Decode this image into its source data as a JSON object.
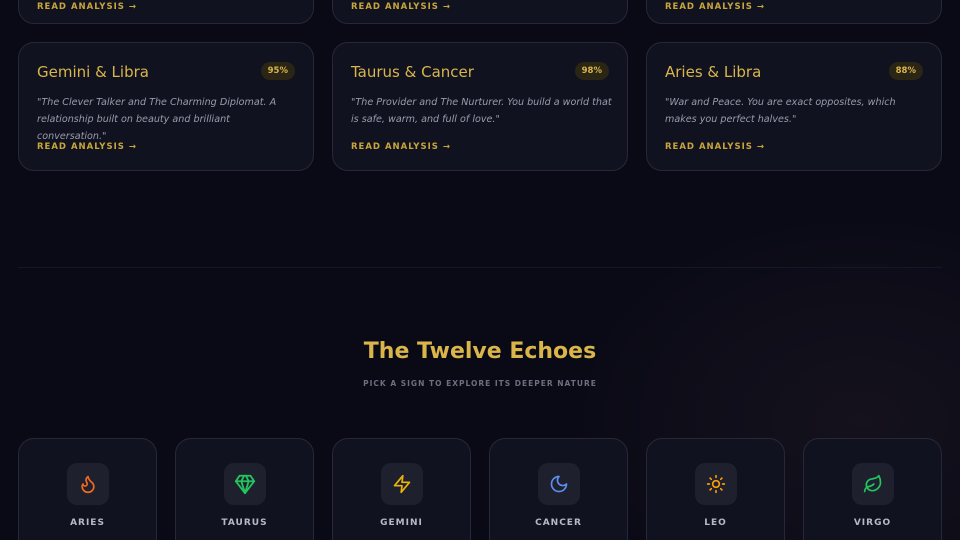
{
  "previous_row": {
    "links": [
      "READ ANALYSIS →",
      "READ ANALYSIS →",
      "READ ANALYSIS →"
    ]
  },
  "matches": [
    {
      "title": "Gemini & Libra",
      "score": "95%",
      "quote": "\"The Clever Talker and The Charming Diplomat. A relationship built on beauty and brilliant conversation.\"",
      "link": "READ ANALYSIS →"
    },
    {
      "title": "Taurus & Cancer",
      "score": "98%",
      "quote": "\"The Provider and The Nurturer. You build a world that is safe, warm, and full of love.\"",
      "link": "READ ANALYSIS →"
    },
    {
      "title": "Aries & Libra",
      "score": "88%",
      "quote": "\"War and Peace. You are exact opposites, which makes you perfect halves.\"",
      "link": "READ ANALYSIS →"
    }
  ],
  "signs_section": {
    "title": "The Twelve Echoes",
    "subtitle": "PICK A SIGN TO EXPLORE ITS DEEPER NATURE",
    "signs": [
      {
        "label": "ARIES",
        "icon": "flame-icon",
        "color": "#f06a1d"
      },
      {
        "label": "TAURUS",
        "icon": "gem-icon",
        "color": "#22c55e"
      },
      {
        "label": "GEMINI",
        "icon": "lightning-icon",
        "color": "#eab308"
      },
      {
        "label": "CANCER",
        "icon": "moon-icon",
        "color": "#5b8def"
      },
      {
        "label": "LEO",
        "icon": "sun-icon",
        "color": "#f59e0b"
      },
      {
        "label": "VIRGO",
        "icon": "leaf-icon",
        "color": "#22c55e"
      }
    ]
  },
  "colors": {
    "accent_gold": "#d9b54a",
    "background": "#0a0a16",
    "card": "#111220"
  }
}
